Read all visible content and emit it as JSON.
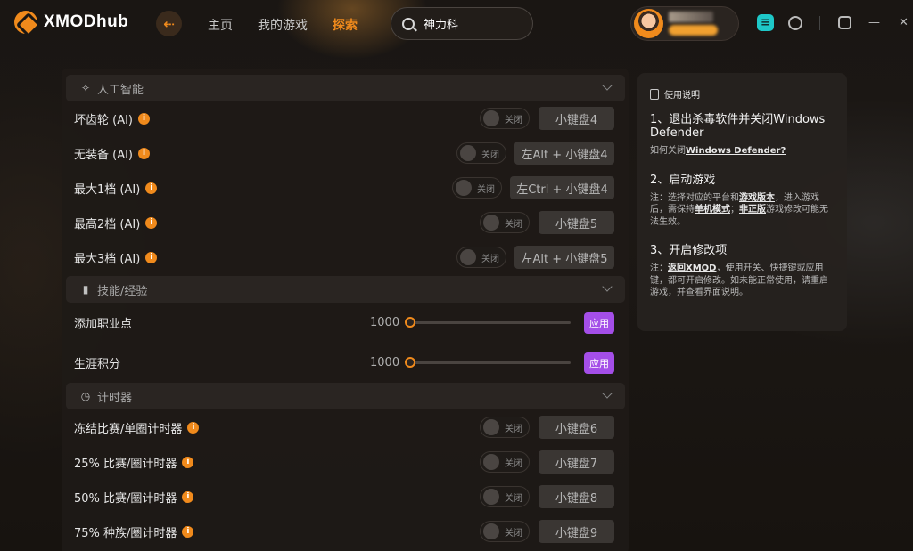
{
  "app": {
    "name": "XMODhub"
  },
  "nav": {
    "items": [
      "主页",
      "我的游戏",
      "探索"
    ],
    "active": 2
  },
  "search": {
    "value": "神力科"
  },
  "sections": {
    "ai": {
      "title": "人工智能",
      "rows": [
        {
          "label": "坏齿轮 (AI)",
          "toggle": "关闭",
          "hotkey": "小键盘4"
        },
        {
          "label": "无装备 (AI)",
          "toggle": "关闭",
          "hotkey": "左Alt + 小键盘4"
        },
        {
          "label": "最大1档 (AI)",
          "toggle": "关闭",
          "hotkey": "左Ctrl + 小键盘4"
        },
        {
          "label": "最高2档 (AI)",
          "toggle": "关闭",
          "hotkey": "小键盘5"
        },
        {
          "label": "最大3档 (AI)",
          "toggle": "关闭",
          "hotkey": "左Alt + 小键盘5"
        }
      ]
    },
    "skills": {
      "title": "技能/经验",
      "rows": [
        {
          "label": "添加职业点",
          "value": "1000",
          "button": "应用"
        },
        {
          "label": "生涯积分",
          "value": "1000",
          "button": "应用"
        }
      ]
    },
    "timer": {
      "title": "计时器",
      "rows": [
        {
          "label": "冻结比赛/单圈计时器",
          "toggle": "关闭",
          "hotkey": "小键盘6"
        },
        {
          "label": "25% 比赛/圈计时器",
          "toggle": "关闭",
          "hotkey": "小键盘7"
        },
        {
          "label": "50% 比赛/圈计时器",
          "toggle": "关闭",
          "hotkey": "小键盘8"
        },
        {
          "label": "75% 种族/圈计时器",
          "toggle": "关闭",
          "hotkey": "小键盘9"
        }
      ]
    }
  },
  "help": {
    "title": "使用说明",
    "step1": {
      "heading": "1、退出杀毒软件并关闭Windows Defender",
      "text_prefix": "如何关闭",
      "link": "Windows Defender?"
    },
    "step2": {
      "heading": "2、启动游戏",
      "p1": "注：选择对应的平台和",
      "l1": "游戏版本",
      "p2": "，进入游戏后，需保持",
      "l2": "单机模式",
      "p3": "；",
      "l3": "非正版",
      "p4": "游戏修改可能无法生效。"
    },
    "step3": {
      "heading": "3、开启修改项",
      "p1": "注：",
      "l1": "返回XMOD",
      "p2": "，使用开关、快捷键或应用键，都可开启修改。如未能正常使用，请重启游戏，并查看界面说明。"
    }
  },
  "colors": {
    "accent": "#f08a1c",
    "apply": "#a44ee8",
    "teal": "#1ec8c8"
  }
}
